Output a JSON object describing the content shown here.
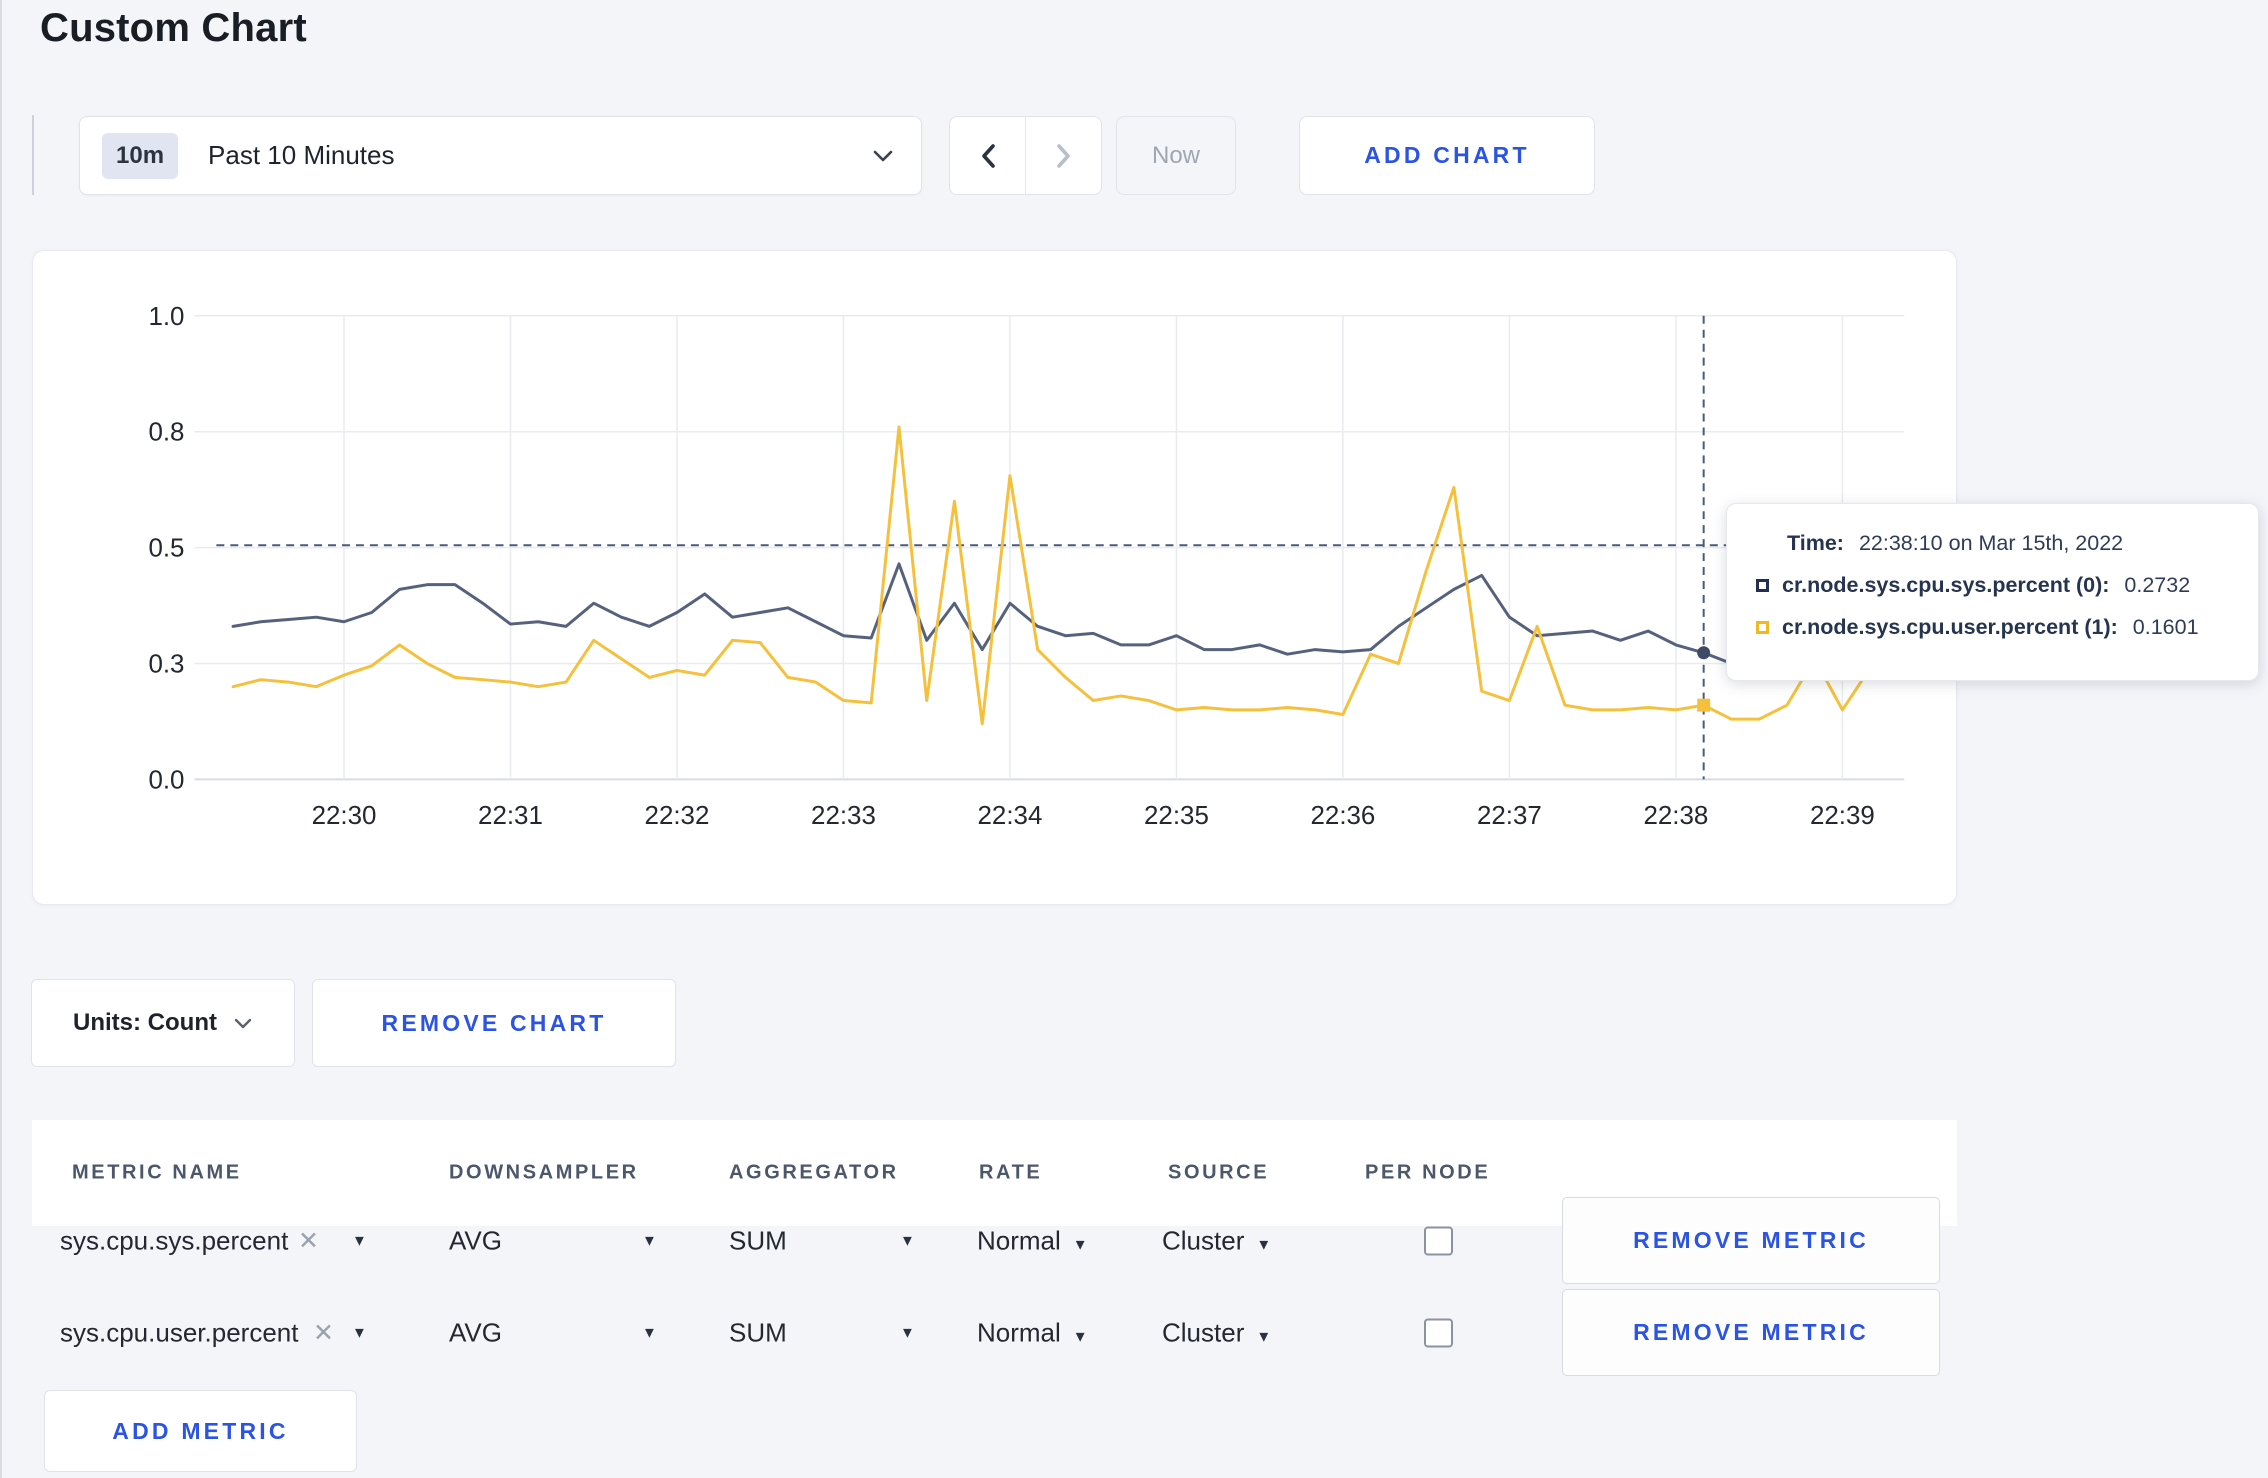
{
  "page": {
    "title": "Custom Chart"
  },
  "toolbar": {
    "range_badge": "10m",
    "range_label": "Past 10 Minutes",
    "now_label": "Now",
    "add_chart_label": "ADD CHART"
  },
  "chart_data": {
    "type": "line",
    "title": "",
    "xlabel": "",
    "ylabel": "",
    "grid": true,
    "legend": "tooltip-only",
    "x_axis": {
      "tick_labels": [
        "22:30",
        "22:31",
        "22:32",
        "22:33",
        "22:34",
        "22:35",
        "22:36",
        "22:37",
        "22:38",
        "22:39"
      ],
      "tick_interval_min": 1,
      "start_offset_min": -0.6667,
      "point_interval_sec": 10
    },
    "y_axis": {
      "lim": [
        0,
        1
      ],
      "ticks": [
        {
          "v": 0.0,
          "label": "0.0"
        },
        {
          "v": 0.25,
          "label": "0.3"
        },
        {
          "v": 0.5,
          "label": "0.5"
        },
        {
          "v": 0.75,
          "label": "0.8"
        },
        {
          "v": 1.0,
          "label": "1.0"
        }
      ]
    },
    "series": [
      {
        "name": "cr.node.sys.cpu.sys.percent (0)",
        "color": "#56617d",
        "values": [
          0.33,
          0.34,
          0.345,
          0.35,
          0.34,
          0.36,
          0.41,
          0.42,
          0.42,
          0.38,
          0.335,
          0.34,
          0.33,
          0.38,
          0.35,
          0.33,
          0.36,
          0.4,
          0.35,
          0.36,
          0.37,
          0.34,
          0.31,
          0.305,
          0.465,
          0.3,
          0.38,
          0.28,
          0.38,
          0.33,
          0.31,
          0.315,
          0.29,
          0.29,
          0.31,
          0.28,
          0.28,
          0.29,
          0.27,
          0.28,
          0.275,
          0.28,
          0.33,
          0.37,
          0.41,
          0.44,
          0.35,
          0.31,
          0.315,
          0.32,
          0.3,
          0.32,
          0.29,
          0.2732,
          0.25,
          0.28,
          0.3,
          0.29,
          0.31,
          0.3
        ]
      },
      {
        "name": "cr.node.sys.cpu.user.percent (1)",
        "color": "#f5c13c",
        "values": [
          0.2,
          0.215,
          0.21,
          0.2,
          0.225,
          0.245,
          0.29,
          0.25,
          0.22,
          0.215,
          0.21,
          0.2,
          0.21,
          0.3,
          0.26,
          0.22,
          0.235,
          0.225,
          0.3,
          0.295,
          0.22,
          0.21,
          0.17,
          0.165,
          0.76,
          0.17,
          0.6,
          0.12,
          0.655,
          0.28,
          0.22,
          0.17,
          0.18,
          0.17,
          0.15,
          0.155,
          0.15,
          0.15,
          0.155,
          0.15,
          0.14,
          0.27,
          0.25,
          0.45,
          0.63,
          0.19,
          0.17,
          0.33,
          0.16,
          0.15,
          0.15,
          0.155,
          0.15,
          0.1601,
          0.13,
          0.13,
          0.16,
          0.26,
          0.15,
          0.24
        ]
      }
    ],
    "crosshair": {
      "time": "22:38:10",
      "time_offset_min": 8.1667,
      "hline_value": 0.505,
      "markers": [
        {
          "series": 0,
          "value": 0.2732
        },
        {
          "series": 1,
          "value": 0.1601
        }
      ]
    }
  },
  "tooltip": {
    "time_label": "Time:",
    "time_value": "22:38:10 on Mar 15th, 2022",
    "series": [
      {
        "label": "cr.node.sys.cpu.sys.percent (0):",
        "value": "0.2732",
        "color": "#242e4d"
      },
      {
        "label": "cr.node.sys.cpu.user.percent (1):",
        "value": "0.1601",
        "color": "#f0b821"
      }
    ]
  },
  "chart_footer": {
    "units_label": "Units: Count",
    "remove_chart_label": "REMOVE CHART"
  },
  "metrics_table": {
    "headers": [
      "METRIC NAME",
      "DOWNSAMPLER",
      "AGGREGATOR",
      "RATE",
      "SOURCE",
      "PER NODE"
    ],
    "rows": [
      {
        "name": "sys.cpu.sys.percent",
        "downsampler": "AVG",
        "aggregator": "SUM",
        "rate": "Normal",
        "source": "Cluster",
        "per_node": false
      },
      {
        "name": "sys.cpu.user.percent",
        "downsampler": "AVG",
        "aggregator": "SUM",
        "rate": "Normal",
        "source": "Cluster",
        "per_node": false
      }
    ],
    "remove_metric_label": "REMOVE METRIC",
    "add_metric_label": "ADD METRIC"
  },
  "icons": {
    "caret_down": "▼",
    "close_x": "✕",
    "chevron_down": "⌄",
    "chevron_left": "‹",
    "chevron_right": "›"
  },
  "colors": {
    "accent_blue": "#2b53e4",
    "series_sys": "#56617d",
    "series_user": "#f5c13c",
    "page_bg": "#f4f5f9",
    "crosshair": "#4a5a78"
  }
}
